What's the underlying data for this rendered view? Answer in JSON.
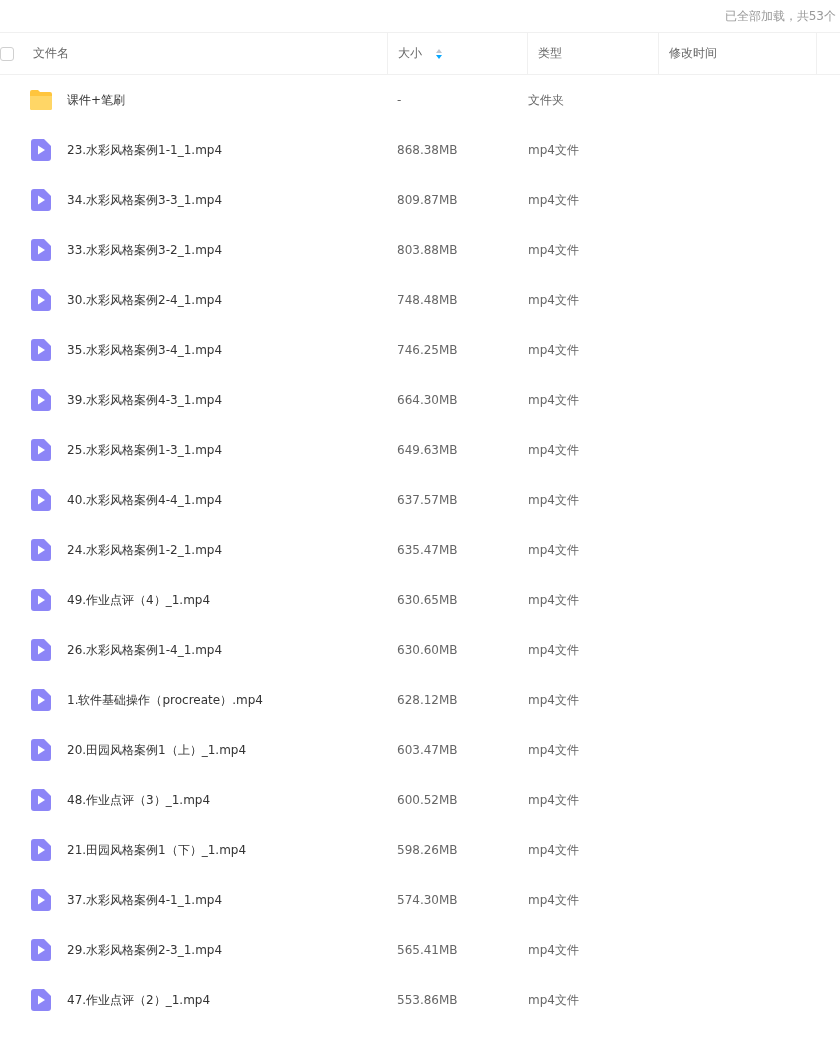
{
  "status": "已全部加载，共53个",
  "header": {
    "checked": false,
    "columns": [
      "文件名",
      "大小",
      "类型",
      "修改时间"
    ]
  },
  "rows": [
    {
      "kind": "folder",
      "name": "课件+笔刷",
      "size": "-",
      "type": "文件夹"
    },
    {
      "kind": "video",
      "name": "23.水彩风格案例1-1_1.mp4",
      "size": "868.38MB",
      "type": "mp4文件"
    },
    {
      "kind": "video",
      "name": "34.水彩风格案例3-3_1.mp4",
      "size": "809.87MB",
      "type": "mp4文件"
    },
    {
      "kind": "video",
      "name": "33.水彩风格案例3-2_1.mp4",
      "size": "803.88MB",
      "type": "mp4文件"
    },
    {
      "kind": "video",
      "name": "30.水彩风格案例2-4_1.mp4",
      "size": "748.48MB",
      "type": "mp4文件"
    },
    {
      "kind": "video",
      "name": "35.水彩风格案例3-4_1.mp4",
      "size": "746.25MB",
      "type": "mp4文件"
    },
    {
      "kind": "video",
      "name": "39.水彩风格案例4-3_1.mp4",
      "size": "664.30MB",
      "type": "mp4文件"
    },
    {
      "kind": "video",
      "name": "25.水彩风格案例1-3_1.mp4",
      "size": "649.63MB",
      "type": "mp4文件"
    },
    {
      "kind": "video",
      "name": "40.水彩风格案例4-4_1.mp4",
      "size": "637.57MB",
      "type": "mp4文件"
    },
    {
      "kind": "video",
      "name": "24.水彩风格案例1-2_1.mp4",
      "size": "635.47MB",
      "type": "mp4文件"
    },
    {
      "kind": "video",
      "name": "49.作业点评（4）_1.mp4",
      "size": "630.65MB",
      "type": "mp4文件"
    },
    {
      "kind": "video",
      "name": "26.水彩风格案例1-4_1.mp4",
      "size": "630.60MB",
      "type": "mp4文件"
    },
    {
      "kind": "video",
      "name": "1.软件基础操作（procreate）.mp4",
      "size": "628.12MB",
      "type": "mp4文件"
    },
    {
      "kind": "video",
      "name": "20.田园风格案例1（上）_1.mp4",
      "size": "603.47MB",
      "type": "mp4文件"
    },
    {
      "kind": "video",
      "name": "48.作业点评（3）_1.mp4",
      "size": "600.52MB",
      "type": "mp4文件"
    },
    {
      "kind": "video",
      "name": "21.田园风格案例1（下）_1.mp4",
      "size": "598.26MB",
      "type": "mp4文件"
    },
    {
      "kind": "video",
      "name": "37.水彩风格案例4-1_1.mp4",
      "size": "574.30MB",
      "type": "mp4文件"
    },
    {
      "kind": "video",
      "name": "29.水彩风格案例2-3_1.mp4",
      "size": "565.41MB",
      "type": "mp4文件"
    },
    {
      "kind": "video",
      "name": "47.作业点评（2）_1.mp4",
      "size": "553.86MB",
      "type": "mp4文件"
    }
  ]
}
